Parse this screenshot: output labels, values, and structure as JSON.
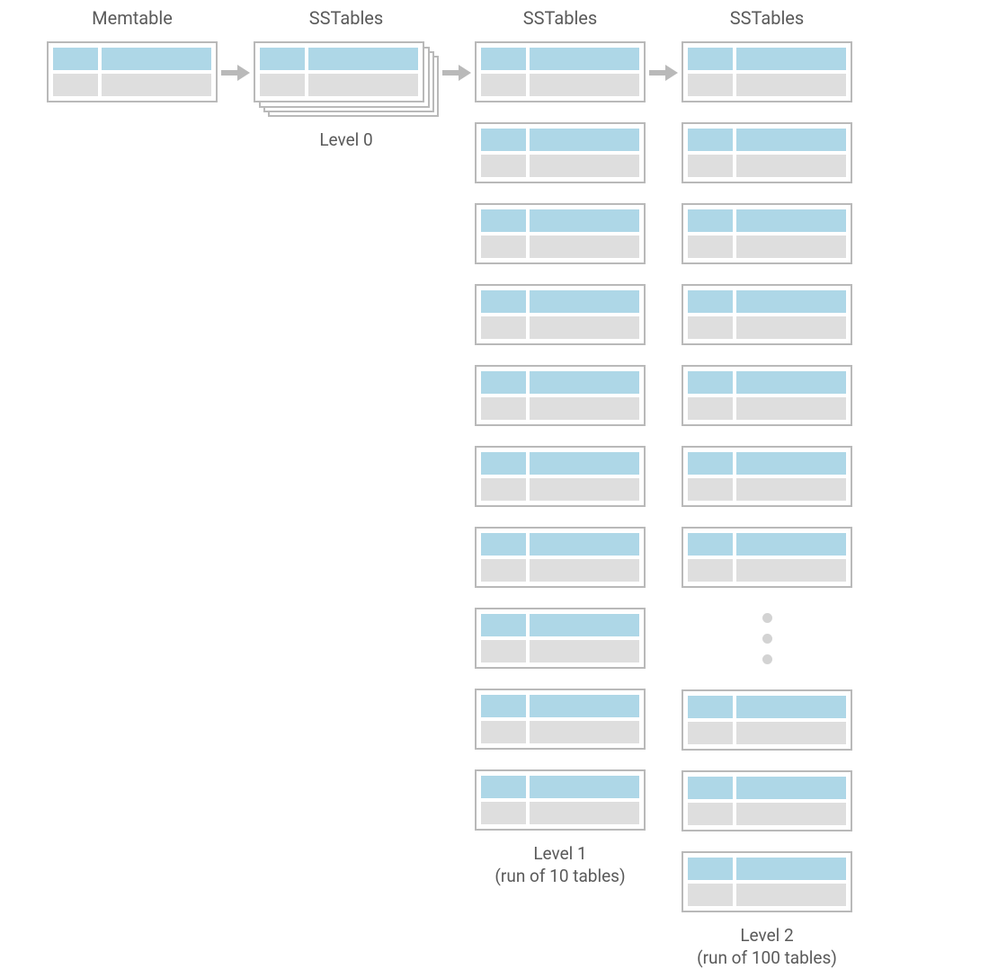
{
  "columns": {
    "memtable": {
      "title": "Memtable"
    },
    "level0": {
      "title": "SSTables",
      "caption": "Level 0",
      "stack_count": 4
    },
    "level1": {
      "title": "SSTables",
      "caption_line1": "Level 1",
      "caption_line2": "(run of 10 tables)",
      "table_count": 10
    },
    "level2": {
      "title": "SSTables",
      "caption_line1": "Level 2",
      "caption_line2": "(run of 100 tables)",
      "tables_before_ellipsis": 7,
      "tables_after_ellipsis": 3,
      "ellipsis_dots": 3
    }
  },
  "colors": {
    "header_row": "#aed7e7",
    "data_row": "#dedede",
    "border": "#b9b9b9",
    "arrow": "#b9b9b9",
    "text": "#5a5a5a"
  }
}
